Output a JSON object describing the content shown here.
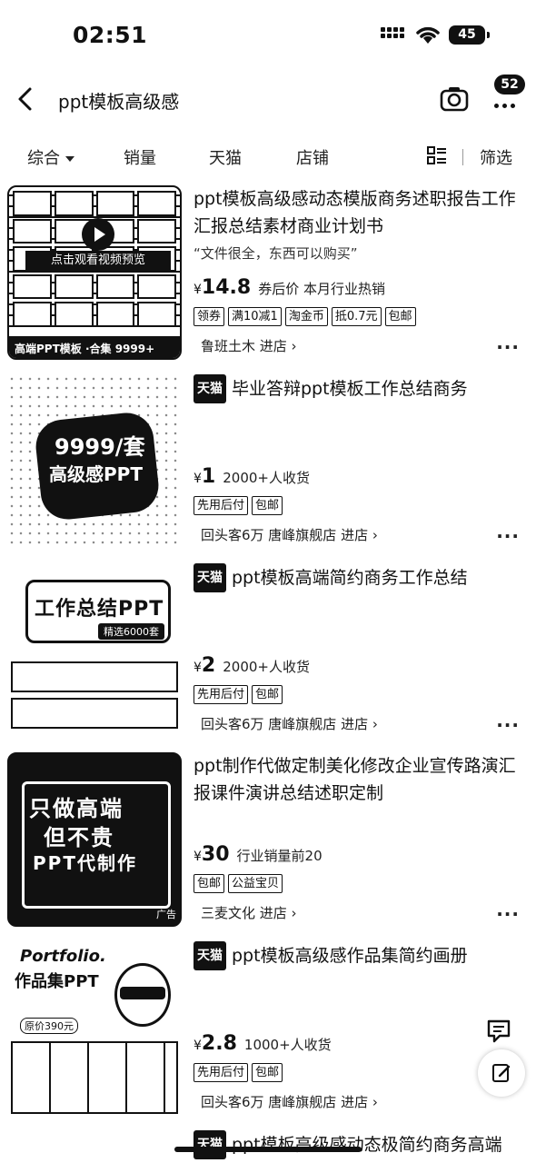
{
  "status_bar": {
    "time": "02:51",
    "battery": "45"
  },
  "header": {
    "query": "ppt模板高级感",
    "message_count": "52"
  },
  "tabs": [
    {
      "label": "综合"
    },
    {
      "label": "销量"
    },
    {
      "label": "天猫"
    },
    {
      "label": "店铺"
    },
    {
      "label": "筛选"
    }
  ],
  "products": [
    {
      "title": "ppt模板高级感动态模版商务述职报告工作汇报总结素材商业计划书",
      "quote": "“文件很全，东西可以购买”",
      "currency": "¥",
      "price": "14.8",
      "price_note": "券后价  本月行业热销",
      "tags": [
        "领券",
        "满10减1",
        "淘金币",
        "抵0.7元",
        "包邮"
      ],
      "shop": "鲁班土木 进店 ›",
      "thumb_text": {
        "mid": "点击观看视频预览",
        "bar": "高端PPT模板 ·合集 9999+"
      }
    },
    {
      "tmall": "天猫",
      "title": "毕业答辩ppt模板工作总结商务",
      "currency": "¥",
      "price": "1",
      "price_note": "2000+人收货",
      "tags": [
        "先用后付",
        "包邮"
      ],
      "shop": "回头客6万  唐峰旗舰店 进店 ›",
      "thumb_text": {
        "line1": "9999/套",
        "line2": "高级感PPT"
      }
    },
    {
      "tmall": "天猫",
      "title": "ppt模板高端简约商务工作总结",
      "currency": "¥",
      "price": "2",
      "price_note": "2000+人收货",
      "tags": [
        "先用后付",
        "包邮"
      ],
      "shop": "回头客6万  唐峰旗舰店 进店 ›",
      "thumb_text": {
        "word": "工作总结PPT",
        "pill": "精选6000套"
      }
    },
    {
      "title": "ppt制作代做定制美化修改企业宣传路演汇报课件演讲总结述职定制",
      "currency": "¥",
      "price": "30",
      "price_note": "行业销量前20",
      "tags": [
        "包邮",
        "公益宝贝"
      ],
      "shop": "三麦文化 进店 ›",
      "thumb_text": {
        "l1": "只做高端",
        "l2": "但不贵",
        "l3": "PPT代制作",
        "ad": "广告"
      }
    },
    {
      "tmall": "天猫",
      "title": "ppt模板高级感作品集简约画册",
      "currency": "¥",
      "price": "2.8",
      "price_note": "1000+人收货",
      "tags": [
        "先用后付",
        "包邮"
      ],
      "shop": "回头客6万  唐峰旗舰店 进店 ›",
      "thumb_text": {
        "pf": "Portfolio.",
        "zp": "作品集PPT",
        "tag": "原价390元"
      }
    },
    {
      "tmall": "天猫",
      "title": "ppt模板高级感动态极简约商务高端"
    }
  ]
}
